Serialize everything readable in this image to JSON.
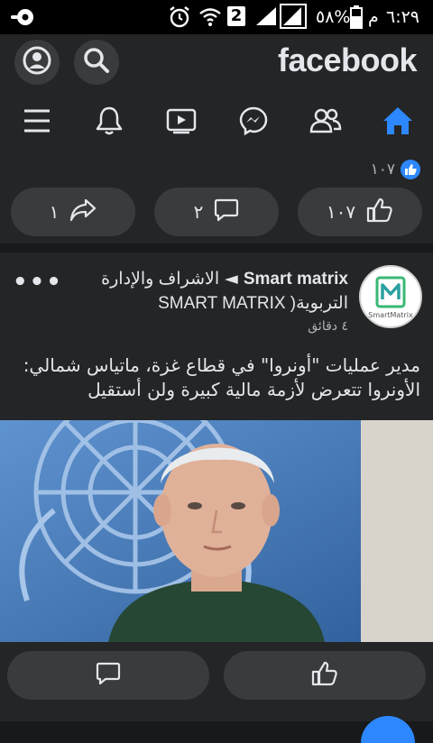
{
  "status_bar": {
    "time": "٦:٢٩",
    "ampm": "م",
    "battery": "٥٨%",
    "sim": "2"
  },
  "header": {
    "logo": "facebook",
    "buttons": {
      "profile": "profile-icon",
      "search": "search-icon"
    }
  },
  "nav": {
    "tabs": [
      "home-icon",
      "friends-icon",
      "messenger-icon",
      "watch-icon",
      "notifications-icon",
      "menu-icon"
    ],
    "active": "home-icon",
    "accent": "#2d88ff"
  },
  "prev_post": {
    "reaction_count": "١٠٧",
    "like_count": "١٠٧",
    "comment_count": "٢",
    "share_count": "١"
  },
  "post": {
    "page_name": "Smart matrix",
    "arrow": "◄",
    "group_name": "الاشراف والإدارة التربوية( SMART MATRIX",
    "time": "٤ دقائق",
    "text": "مدير عمليات \"أونروا\" في قطاع غزة، ماتياس شمالي: الأونروا تتعرض لأزمة مالية كبيرة ولن أستقيل",
    "avatar_text": "SmartMatrix",
    "more": "•••"
  },
  "colors": {
    "background": "#18191a",
    "card": "#242526",
    "button": "#3a3b3c",
    "text": "#e4e6eb",
    "secondary": "#b0b3b8",
    "accent": "#2d88ff"
  }
}
